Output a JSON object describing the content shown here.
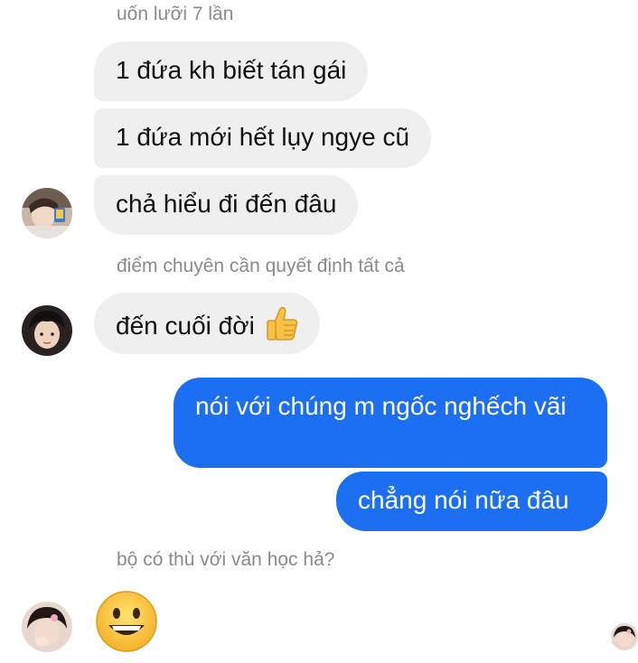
{
  "thread": {
    "meta_1": "uốn lưỡi 7 lần",
    "msg_1": "1 đứa kh biết tán gái",
    "msg_2": "1 đứa mới hết lụy ngye cũ",
    "msg_3": "chả hiểu đi đến đâu",
    "meta_2": "điểm chuyên cần quyết định tất cả",
    "msg_4": "đến cuối đời",
    "msg_4_emoji": "thumbs-up-icon",
    "out_1": "nói với chúng m ngốc nghếch vãi",
    "out_2": "chẳng nói nữa đâu",
    "meta_3": "bộ có thù với văn học hả?",
    "msg_5_emoji": "grinning-face-icon"
  },
  "colors": {
    "incoming_bubble": "#efefef",
    "outgoing_bubble": "#1c6ef2",
    "meta_text": "#8a8a8e"
  }
}
